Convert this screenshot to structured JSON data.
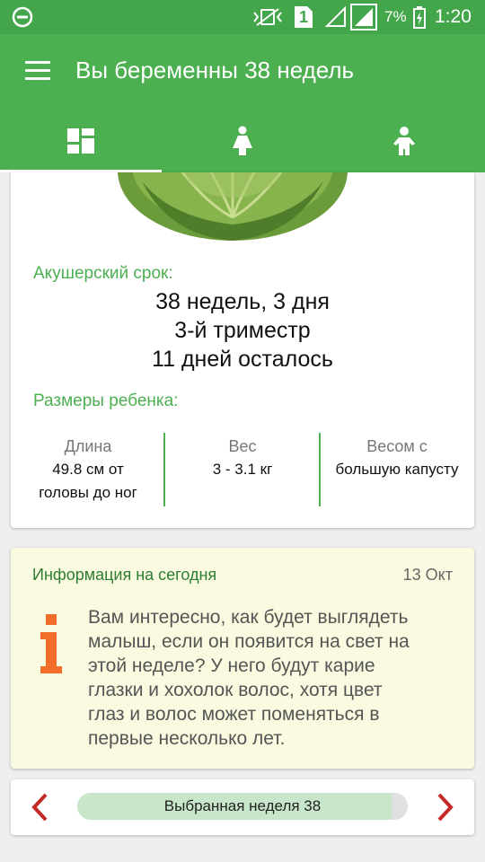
{
  "status_bar": {
    "battery_percent": "7%",
    "time": "1:20",
    "sim_label": "1",
    "icons": [
      "minus-circle-icon",
      "mute-vibrate-icon",
      "sim-icon",
      "signal-icon",
      "signal-icon",
      "battery-charging-icon"
    ]
  },
  "app_bar": {
    "title": "Вы беременны 38 недель",
    "menu_icon": "hamburger-icon"
  },
  "tabs": [
    {
      "icon": "dashboard-icon",
      "selected": true
    },
    {
      "icon": "woman-icon",
      "selected": false
    },
    {
      "icon": "child-icon",
      "selected": false
    }
  ],
  "term": {
    "label": "Акушерский срок:",
    "weeks_days": "38 недель, 3 дня",
    "trimester": "3-й триместр",
    "days_left": "11 дней осталось"
  },
  "baby_size": {
    "label": "Размеры ребенка:",
    "length": {
      "header": "Длина",
      "line1": "49.8 см от",
      "line2": "головы до ног"
    },
    "weight": {
      "header": "Вес",
      "value": "3 - 3.1 кг"
    },
    "comparison": {
      "header": "Весом с",
      "value": "большую капусту"
    }
  },
  "info": {
    "title": "Информация на сегодня",
    "date": "13 Окт",
    "icon": "info-icon",
    "text_lines": [
      "Вам интересно, как будет выглядеть",
      "малыш, если он появится на свет на",
      "этой неделе? У него будут карие",
      "глазки и хохолок волос, хотя цвет",
      "глаз и волос может поменяться в",
      "первые несколько лет."
    ]
  },
  "week_nav": {
    "label": "Выбранная неделя 38",
    "progress_fraction": 0.95,
    "prev_icon": "chevron-left-icon",
    "next_icon": "chevron-right-icon"
  },
  "colors": {
    "primary": "#4caf50",
    "primary_dark": "#43a64b",
    "accent": "#c62828",
    "info_icon": "#f26c2a",
    "info_bg": "#fafae0"
  }
}
